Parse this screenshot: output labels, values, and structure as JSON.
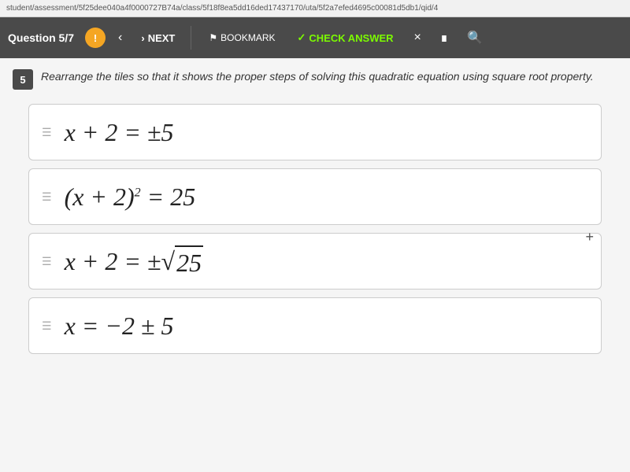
{
  "urlbar": {
    "url": "student/assessment/5f25dee040a4f0000727B74a/class/5f18f8ea5dd16ded17437170/uta/5f2a7efed4695c00081d5db1/qid/4"
  },
  "toolbar": {
    "question_label": "Question 5/7",
    "alert_icon": "!",
    "nav_back": "<",
    "nav_next_label": "NEXT",
    "bookmark_label": "BOOKMARK",
    "check_answer_label": "CHECK ANSWER",
    "close_label": "×"
  },
  "question": {
    "number": "5",
    "text": "Rearrange the tiles so that it shows the proper steps of solving this quadratic equation using square root property."
  },
  "tiles": [
    {
      "id": 1,
      "math_html": "x + 2 = &#xb1;5"
    },
    {
      "id": 2,
      "math_html": "(x + 2)<sup>2</sup> = 25"
    },
    {
      "id": 3,
      "math_html": "x + 2 = &#xb1;&#x221a;25"
    },
    {
      "id": 4,
      "math_html": "x = &minus;2 &#xb1; 5"
    }
  ],
  "plus_sign": "+"
}
